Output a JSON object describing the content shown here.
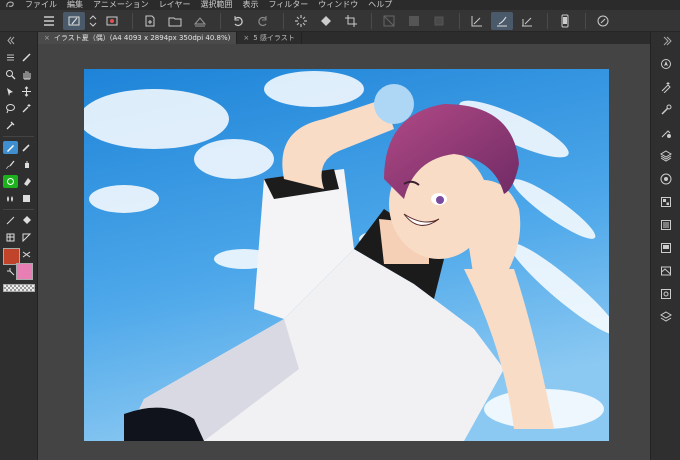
{
  "menu": {
    "items": [
      "ファイル",
      "編集",
      "アニメーション",
      "レイヤー",
      "選択範囲",
      "表示",
      "フィルター",
      "ウィンドウ",
      "ヘルプ"
    ]
  },
  "toolbar": {
    "icons": [
      "menu-icon",
      "brush-select-icon",
      "stepper-icon",
      "record-icon",
      "new-file-icon",
      "open-folder-icon",
      "save-icon",
      "undo-icon",
      "redo-icon",
      "loading-icon",
      "fill-icon",
      "crop-icon",
      "layer-off-icon",
      "layer-mid-icon",
      "layer-dark-icon",
      "ruler-icon",
      "pen-ruler-icon",
      "ruler-alt-icon",
      "phone-icon",
      "pen-circle-icon"
    ]
  },
  "tabs": [
    {
      "label": "イラスト夏（偶）(A4 4093 x 2894px 350dpi 40.8%)",
      "active": true
    },
    {
      "label": "5 感イラスト",
      "active": false
    }
  ],
  "colors": {
    "main": "#c0442a",
    "sub": "#e77fb5",
    "accent": "#3f8fd0"
  }
}
